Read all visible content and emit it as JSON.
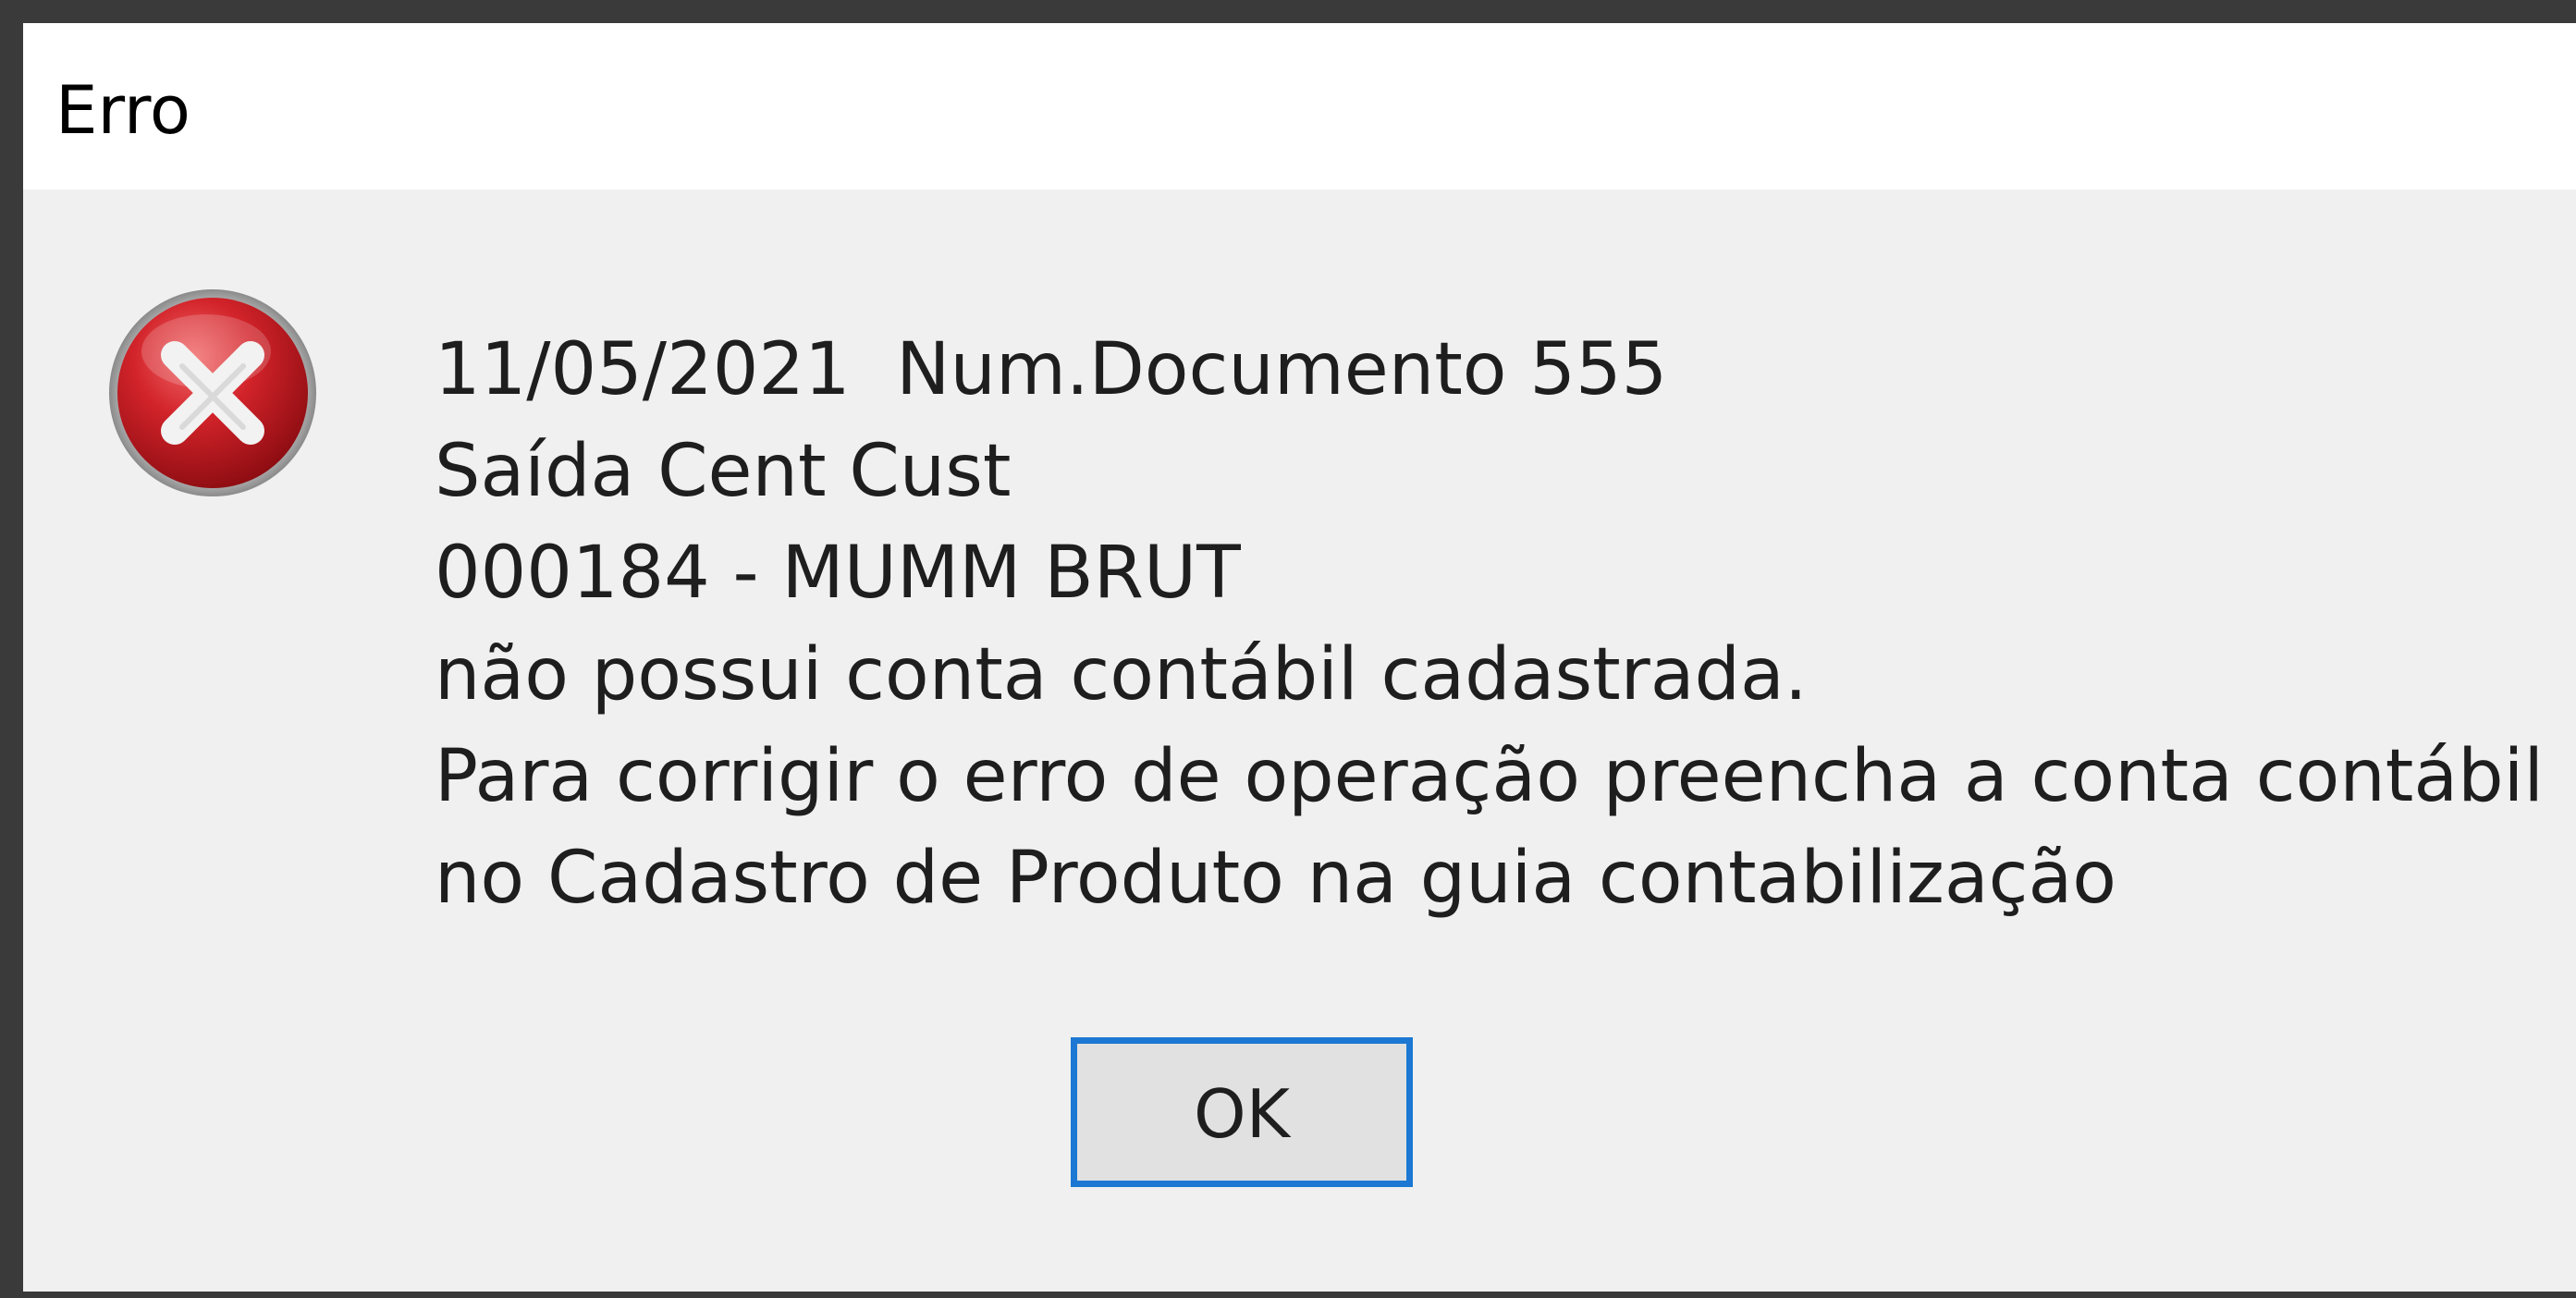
{
  "window": {
    "title": "Erro"
  },
  "dialog": {
    "icon": "error-icon",
    "message_lines": [
      "11/05/2021  Num.Documento 555",
      "Saída Cent Cust",
      "000184 - MUMM BRUT",
      "não possui conta contábil cadastrada.",
      "Para corrigir o erro de operação preencha a conta contábil",
      "no Cadastro de Produto na guia contabilização"
    ],
    "ok_label": "OK"
  },
  "colors": {
    "icon_red": "#c4161c",
    "button_focus_border": "#1c78d2",
    "dialog_background": "#f0f0f0"
  }
}
